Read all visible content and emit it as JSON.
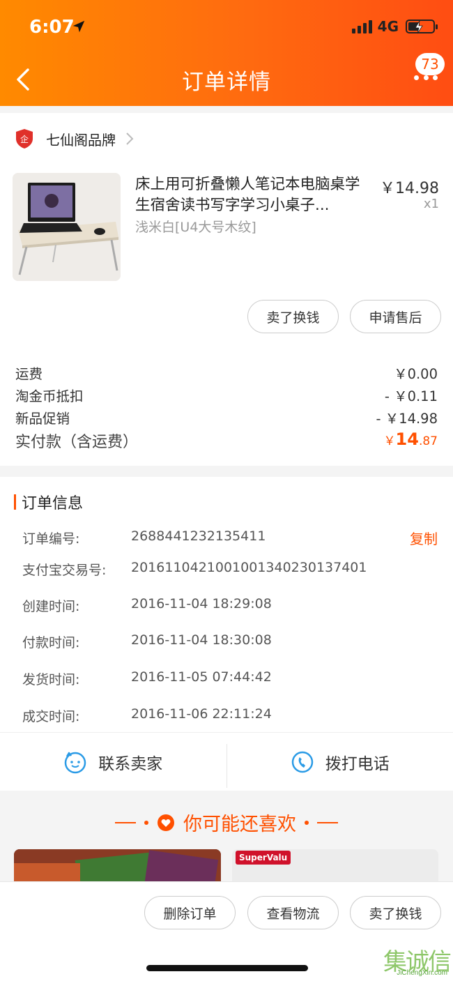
{
  "status_bar": {
    "time": "6:07",
    "network": "4G"
  },
  "header": {
    "title": "订单详情",
    "badge_count": "73"
  },
  "store": {
    "name": "七仙阁品牌"
  },
  "item": {
    "title": "床上用可折叠懒人笔记本电脑桌学生宿舍读书写字学习小桌子...",
    "sku": "浅米白[U4大号木纹]",
    "price": "￥14.98",
    "quantity": "x1"
  },
  "item_actions": {
    "sell": "卖了换钱",
    "after_sale": "申请售后"
  },
  "summary": {
    "shipping_label": "运费",
    "shipping_value": "￥0.00",
    "coin_label": "淘金币抵扣",
    "coin_value": "- ￥0.11",
    "promo_label": "新品促销",
    "promo_value": "- ￥14.98",
    "total_label": "实付款（含运费）",
    "total_currency": "￥",
    "total_int": "14",
    "total_dec": ".87"
  },
  "order_info": {
    "title": "订单信息",
    "copy_label": "复制",
    "rows": [
      {
        "label": "订单编号:",
        "value": "2688441232135411"
      },
      {
        "label": "支付宝交易号:",
        "value": "2016110421001001340230137401"
      },
      {
        "label": "创建时间:",
        "value": "2016-11-04 18:29:08"
      },
      {
        "label": "付款时间:",
        "value": "2016-11-04 18:30:08"
      },
      {
        "label": "发货时间:",
        "value": "2016-11-05 07:44:42"
      },
      {
        "label": "成交时间:",
        "value": "2016-11-06 22:11:24"
      }
    ]
  },
  "contact": {
    "seller": "联系卖家",
    "call": "拨打电话"
  },
  "recommend": {
    "title": "你可能还喜欢",
    "card2_logo": "SuperValu"
  },
  "bottom_actions": {
    "delete": "删除订单",
    "logistics": "查看物流",
    "sell": "卖了换钱"
  },
  "watermark": {
    "chars": "集诚信",
    "url": "JiChengXin.com"
  },
  "colors": {
    "accent": "#ff5000",
    "header_start": "#ff8a00",
    "header_end": "#ff4d12"
  }
}
